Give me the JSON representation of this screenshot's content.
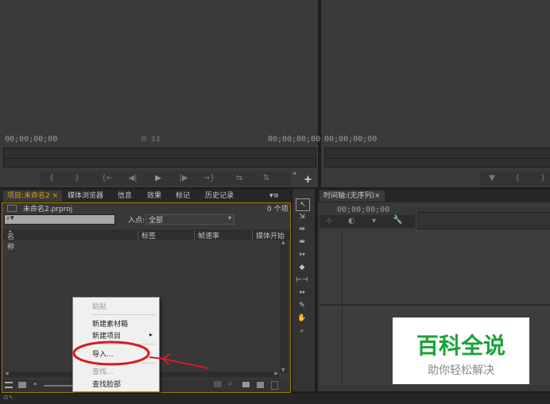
{
  "source_monitor": {
    "timecode_left": "00;00;00;00",
    "timecode_right": "00;00;00;00",
    "marks": "⊟ ‡‡",
    "controls": [
      "{",
      "}",
      "{←",
      "◀|",
      "▶",
      "|▶",
      "→}",
      "⇆",
      "⇅",
      "»",
      "+"
    ]
  },
  "program_monitor": {
    "timecode": "00;00;00;00",
    "controls": [
      "▼",
      "{",
      "}"
    ]
  },
  "project_panel": {
    "tabs": [
      "项目:未命名2 ×",
      "媒体浏览器",
      "信息",
      "效果",
      "标记",
      "历史记录"
    ],
    "menu_icon": "▾≡",
    "file_name": "未命名2.prproj",
    "item_count": "0 个项",
    "search_placeholder": "",
    "in_point_label": "入点:",
    "in_point_value": "全部",
    "columns": [
      "名称",
      "标签",
      "帧速率",
      "媒体开始"
    ],
    "bottom_icons": [
      "list-view",
      "icon-view",
      "zoom-out",
      "slider",
      "automate",
      "find",
      "new-bin",
      "new-item",
      "delete"
    ]
  },
  "context_menu": {
    "items": [
      {
        "label": "粘贴",
        "disabled": true
      },
      {
        "label": "新建素材箱",
        "disabled": false
      },
      {
        "label": "新建项目",
        "disabled": false,
        "submenu": true
      },
      {
        "label": "导入...",
        "disabled": false
      },
      {
        "label": "查找...",
        "disabled": true
      },
      {
        "label": "查找脸部",
        "disabled": false
      }
    ]
  },
  "timeline": {
    "tab": "时间轴:(无序列)×",
    "timecode": "00;00;00;00"
  },
  "tools": [
    "selection",
    "track-select",
    "ripple-edit",
    "rolling-edit",
    "rate-stretch",
    "razor",
    "slip",
    "slide",
    "pen",
    "hand",
    "zoom"
  ],
  "watermark": {
    "title": "百科全说",
    "subtitle": "助你轻松解决",
    "color": "#1aa33a"
  },
  "status_bar": "⊙↖",
  "colors": {
    "accent": "#e0a000",
    "annotation": "#d61c22"
  }
}
